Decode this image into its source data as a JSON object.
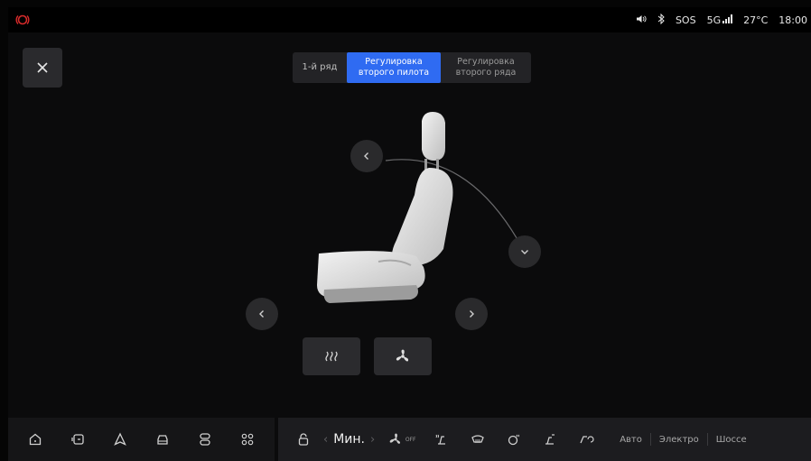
{
  "status_bar": {
    "alert_icon": "brake-warning-icon",
    "alert_color": "#d62a2a",
    "volume_icon": "volume-icon",
    "bluetooth_icon": "bluetooth-icon",
    "sos": "SOS",
    "network": "5G",
    "temperature": "27°C",
    "time": "18:00"
  },
  "close_icon": "close-icon",
  "tabs": [
    {
      "label": "1-й ряд",
      "active": false
    },
    {
      "label": "Регулировка второго пилота",
      "active": true
    },
    {
      "label": "Регулировка второго ряда",
      "active": false
    }
  ],
  "seat_controls": {
    "backrest_back": "chevron-left-icon",
    "backrest_forward": "chevron-down-icon",
    "slide_back": "chevron-left-icon",
    "slide_forward": "chevron-right-icon"
  },
  "feature_buttons": [
    {
      "icon": "seat-heat-icon"
    },
    {
      "icon": "seat-ventilation-icon"
    }
  ],
  "nav_bar": [
    {
      "icon": "home-icon"
    },
    {
      "icon": "media-icon"
    },
    {
      "icon": "navigation-icon"
    },
    {
      "icon": "car-icon"
    },
    {
      "icon": "settings-toggle-icon"
    },
    {
      "icon": "apps-icon"
    }
  ],
  "climate_bar": {
    "lock_icon": "lock-icon",
    "fan_level": "Мин.",
    "fan_prev": "‹",
    "fan_next": "›",
    "fan_off_label": "OFF",
    "icons": [
      "fan-icon",
      "seat-heat-small-icon",
      "front-defrost-icon",
      "steering-heat-icon",
      "seat-fan-small-icon",
      "recirculation-icon"
    ],
    "modes": [
      "Авто",
      "Электро",
      "Шоссе"
    ]
  },
  "colors": {
    "accent": "#2f6bf2",
    "background": "#0b0b0c",
    "panel": "#232326"
  }
}
